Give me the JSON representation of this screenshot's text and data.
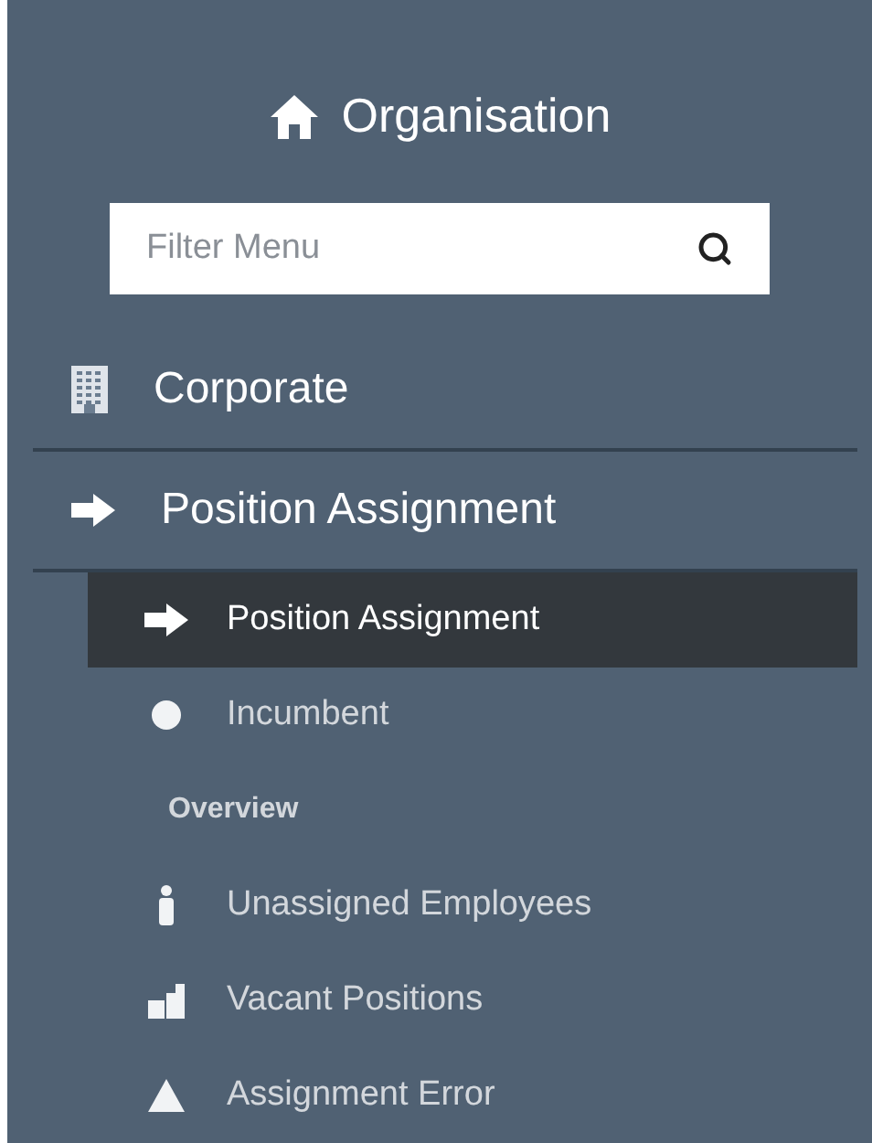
{
  "header": {
    "title": "Organisation"
  },
  "search": {
    "placeholder": "Filter Menu"
  },
  "menu": [
    {
      "label": "Corporate"
    },
    {
      "label": "Position Assignment",
      "children": [
        {
          "kind": "item",
          "label": "Position Assignment",
          "selected": true
        },
        {
          "kind": "item",
          "label": "Incumbent",
          "selected": false
        },
        {
          "kind": "heading",
          "label": "Overview"
        },
        {
          "kind": "item",
          "label": "Unassigned Employees",
          "selected": false
        },
        {
          "kind": "item",
          "label": "Vacant Positions",
          "selected": false
        },
        {
          "kind": "item",
          "label": "Assignment Error",
          "selected": false
        }
      ]
    }
  ]
}
